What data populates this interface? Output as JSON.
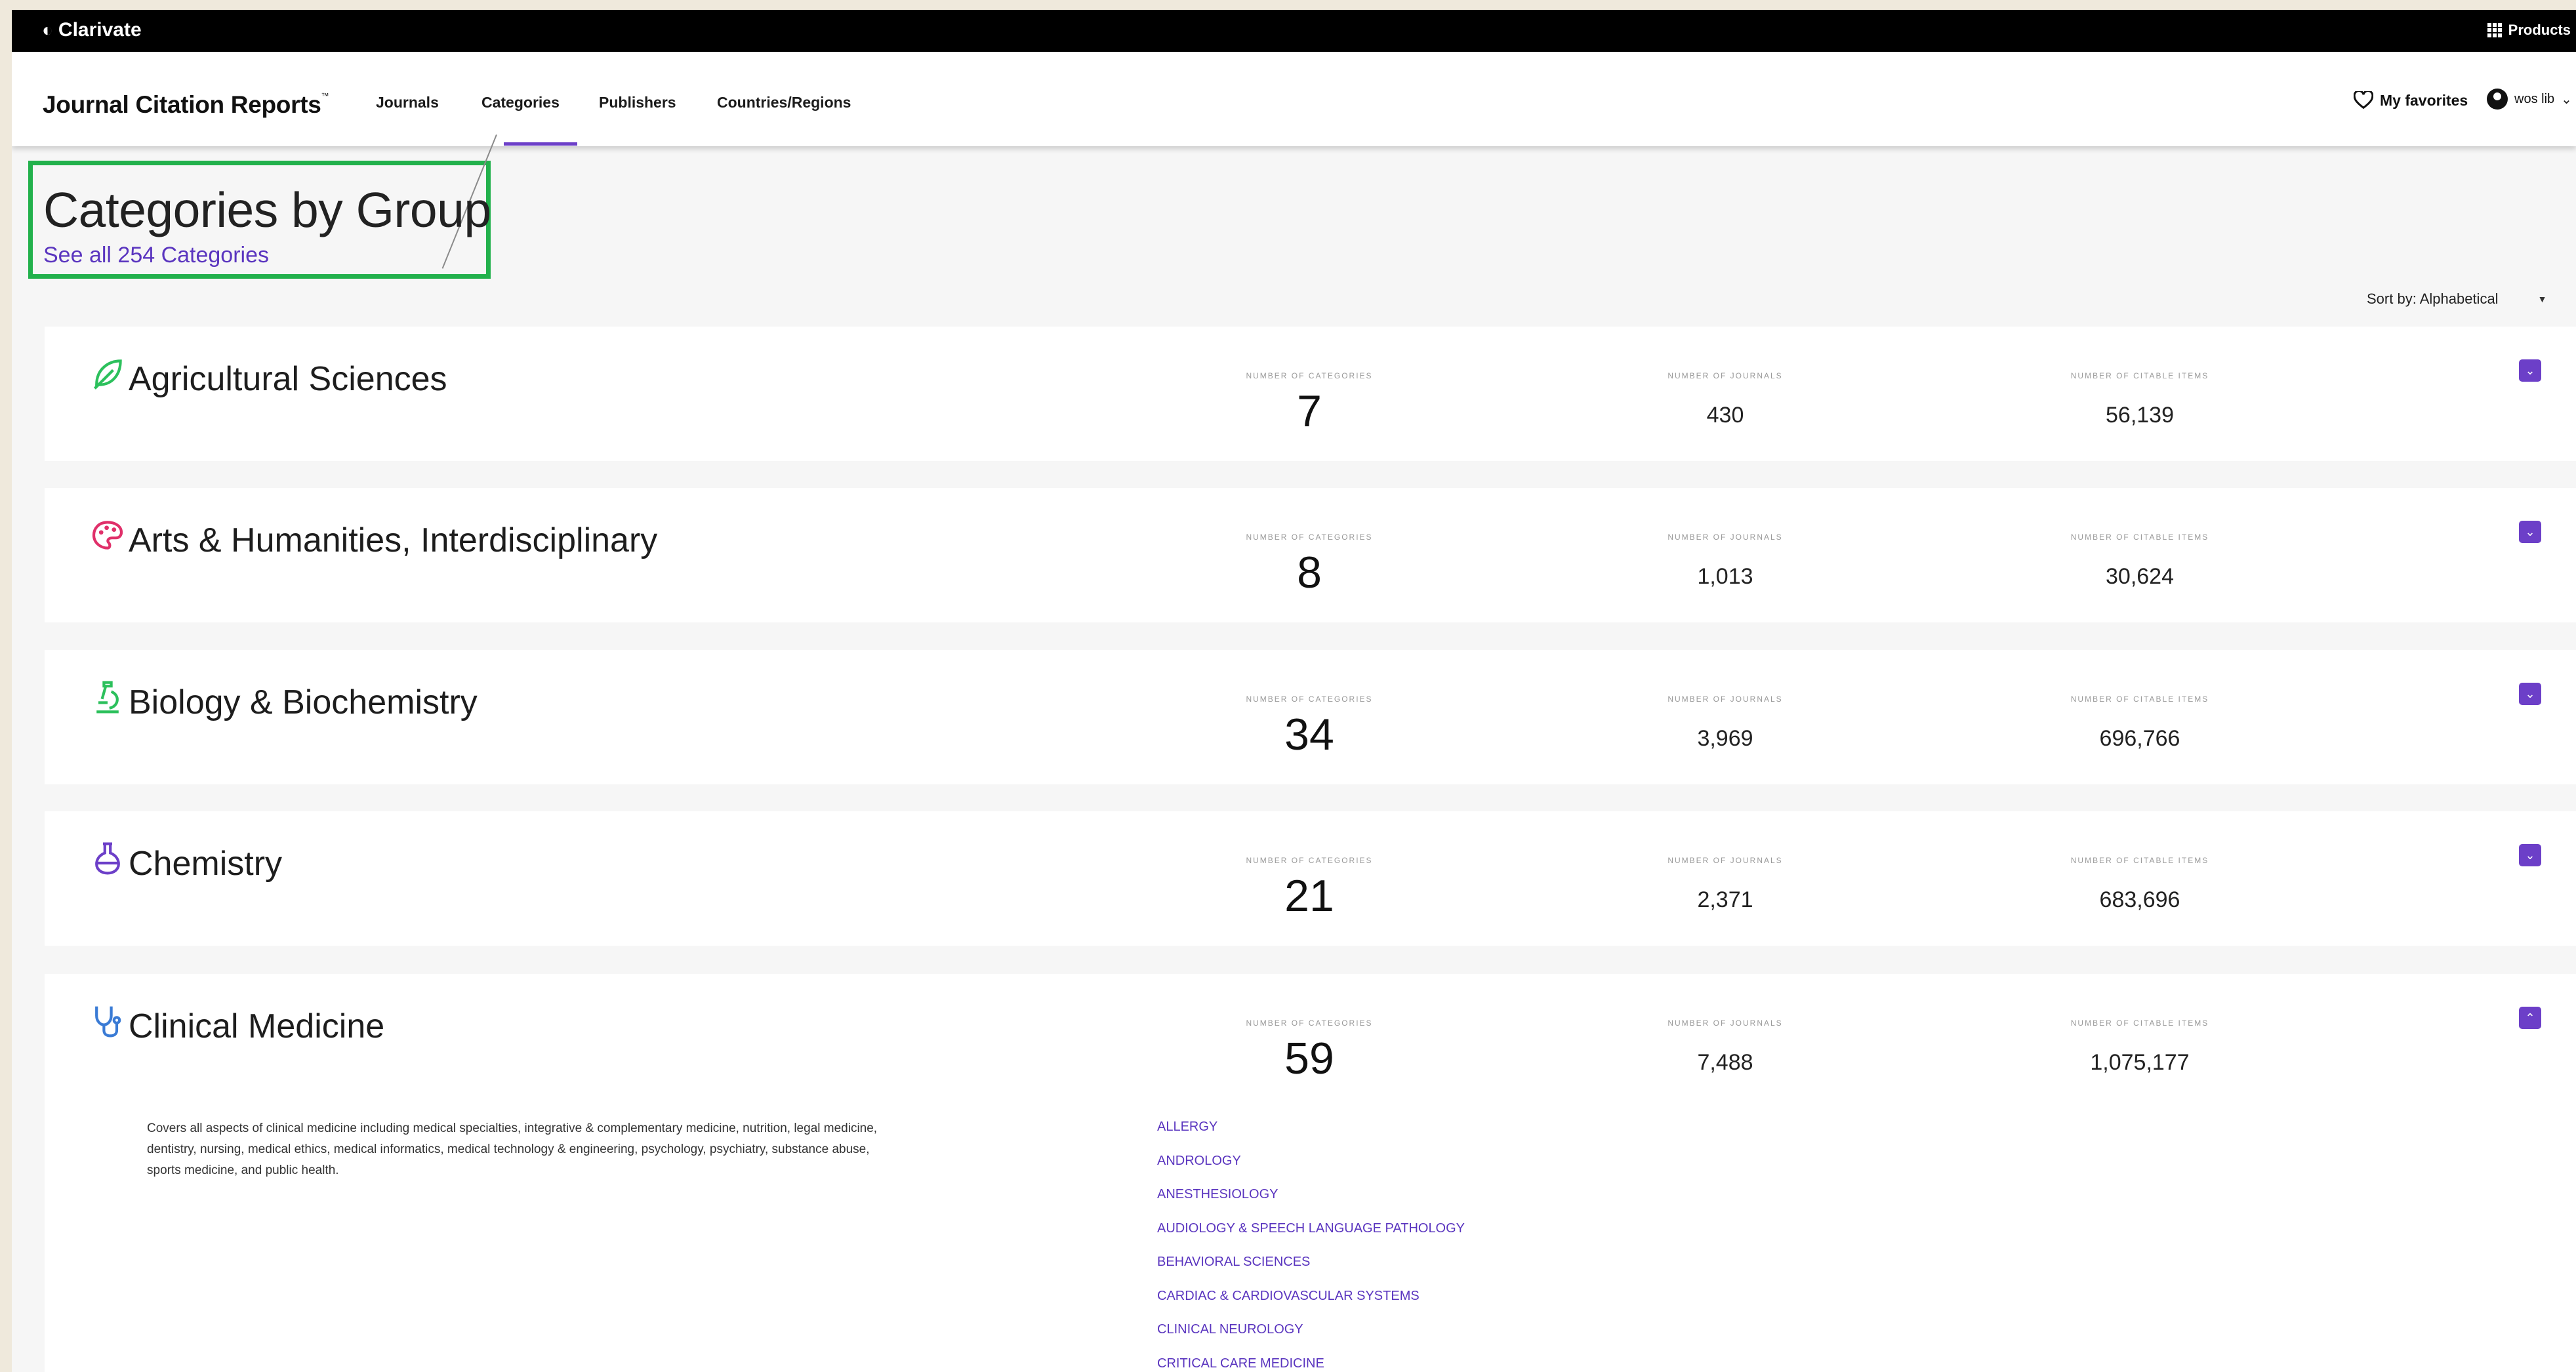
{
  "topbar": {
    "brand": "Clarivate",
    "products": "Products"
  },
  "nav": {
    "logo": "Journal Citation Reports",
    "logo_tm": "™",
    "tabs": [
      "Journals",
      "Categories",
      "Publishers",
      "Countries/Regions"
    ],
    "active_tab": "Categories",
    "favorites": "My favorites",
    "user": "wos lib"
  },
  "page": {
    "title": "Categories by Group",
    "see_all": "See all 254 Categories",
    "sort_label": "Sort by: Alphabetical"
  },
  "labels": {
    "categories": "NUMBER OF CATEGORIES",
    "journals": "NUMBER OF JOURNALS",
    "citable": "NUMBER OF CITABLE ITEMS"
  },
  "groups": [
    {
      "name": "Agricultural Sciences",
      "icon": "leaf-icon",
      "categories": "7",
      "journals": "430",
      "citable": "56,139",
      "expanded": false
    },
    {
      "name": "Arts & Humanities, Interdisciplinary",
      "icon": "palette-icon",
      "categories": "8",
      "journals": "1,013",
      "citable": "30,624",
      "expanded": false
    },
    {
      "name": "Biology & Biochemistry",
      "icon": "microscope-icon",
      "categories": "34",
      "journals": "3,969",
      "citable": "696,766",
      "expanded": false
    },
    {
      "name": "Chemistry",
      "icon": "flask-icon",
      "categories": "21",
      "journals": "2,371",
      "citable": "683,696",
      "expanded": false
    },
    {
      "name": "Clinical Medicine",
      "icon": "stethoscope-icon",
      "categories": "59",
      "journals": "7,488",
      "citable": "1,075,177",
      "expanded": true,
      "description": "Covers all aspects of clinical medicine including medical specialties, integrative & complementary medicine, nutrition, legal medicine, dentistry, nursing, medical ethics, medical informatics, medical technology & engineering, psychology, psychiatry, substance abuse, sports medicine, and public health.",
      "category_list": [
        "ALLERGY",
        "ANDROLOGY",
        "ANESTHESIOLOGY",
        "AUDIOLOGY & SPEECH LANGUAGE PATHOLOGY",
        "BEHAVIORAL SCIENCES",
        "CARDIAC & CARDIOVASCULAR SYSTEMS",
        "CLINICAL NEUROLOGY",
        "CRITICAL CARE MEDICINE"
      ]
    }
  ],
  "colors": {
    "accent": "#6c3fc8",
    "highlight": "#22b14c",
    "leaf": "#2cc05c",
    "palette": "#e0306a",
    "microscope": "#2cc05c",
    "flask": "#6c3fc8",
    "stethoscope": "#3a7bd5"
  }
}
